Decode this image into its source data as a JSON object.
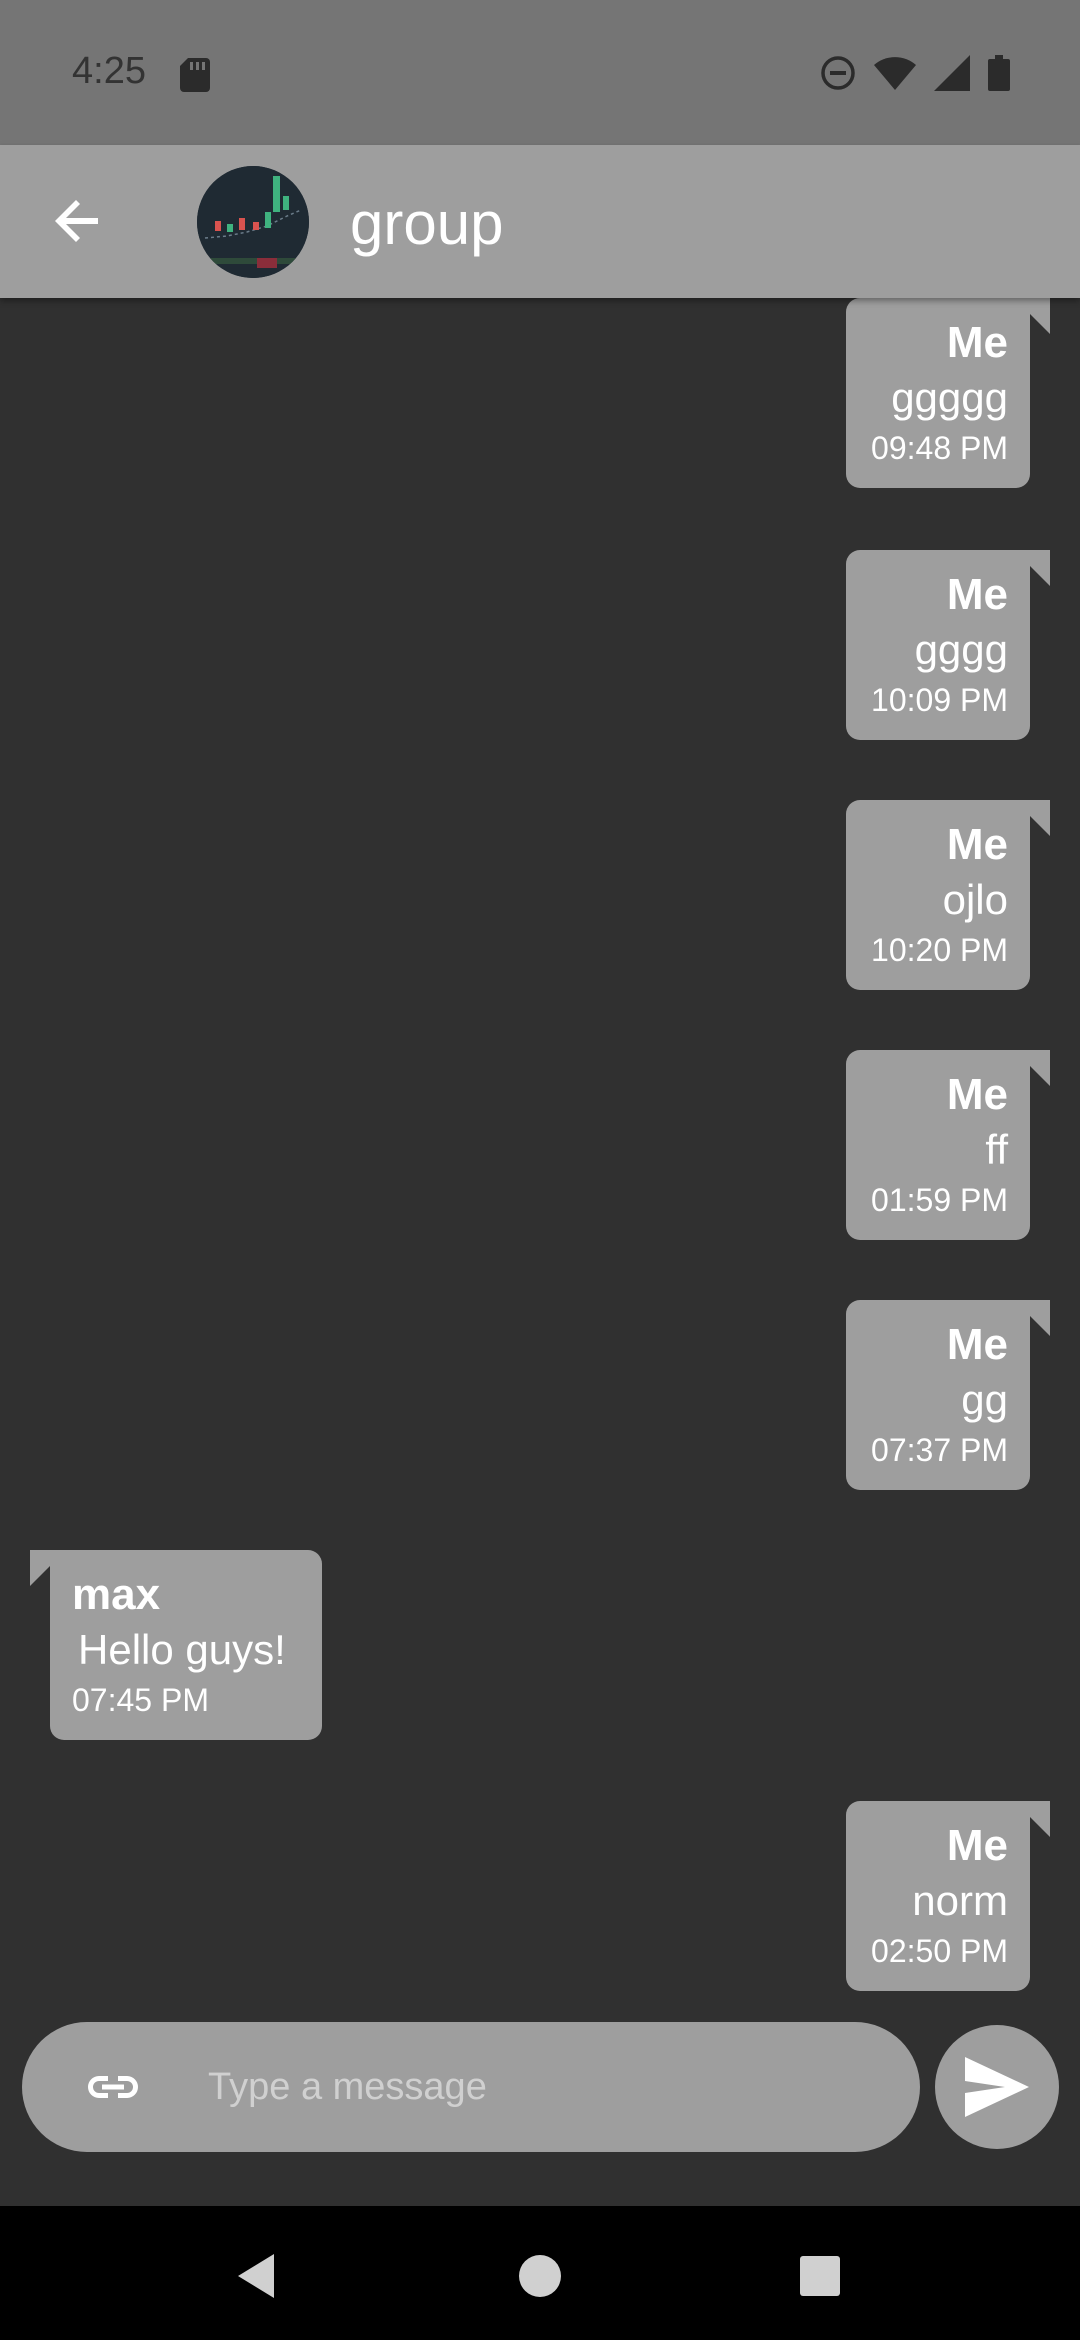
{
  "status_bar": {
    "time": "4:25",
    "icons": [
      "sd-card-icon",
      "dnd-icon",
      "wifi-icon",
      "cell-signal-icon",
      "battery-icon"
    ]
  },
  "app_bar": {
    "title": "group",
    "back_icon": "arrow-back-icon",
    "avatar": "group-avatar"
  },
  "messages": [
    {
      "sender": "Me",
      "text": "ggggg",
      "time": "09:48 PM",
      "own": true
    },
    {
      "sender": "Me",
      "text": "gggg",
      "time": "10:09 PM",
      "own": true
    },
    {
      "sender": "Me",
      "text": "ojlo",
      "time": "10:20 PM",
      "own": true
    },
    {
      "sender": "Me",
      "text": "ff",
      "time": "01:59 PM",
      "own": true
    },
    {
      "sender": "Me",
      "text": "gg",
      "time": "07:37 PM",
      "own": true
    },
    {
      "sender": "max",
      "text": "Hello guys!",
      "time": "07:45 PM",
      "own": false
    },
    {
      "sender": "Me",
      "text": "norm",
      "time": "02:50 PM",
      "own": true
    }
  ],
  "composer": {
    "placeholder": "Type a message",
    "value": "",
    "attach_icon": "link-icon",
    "send_icon": "send-icon"
  },
  "nav_bar": {
    "icons": [
      "nav-back-icon",
      "nav-home-icon",
      "nav-recents-icon"
    ]
  },
  "colors": {
    "background": "#303030",
    "app_bar": "#9e9e9e",
    "status_bar": "#757575",
    "bubble": "#9e9e9e",
    "text": "#ffffff"
  }
}
